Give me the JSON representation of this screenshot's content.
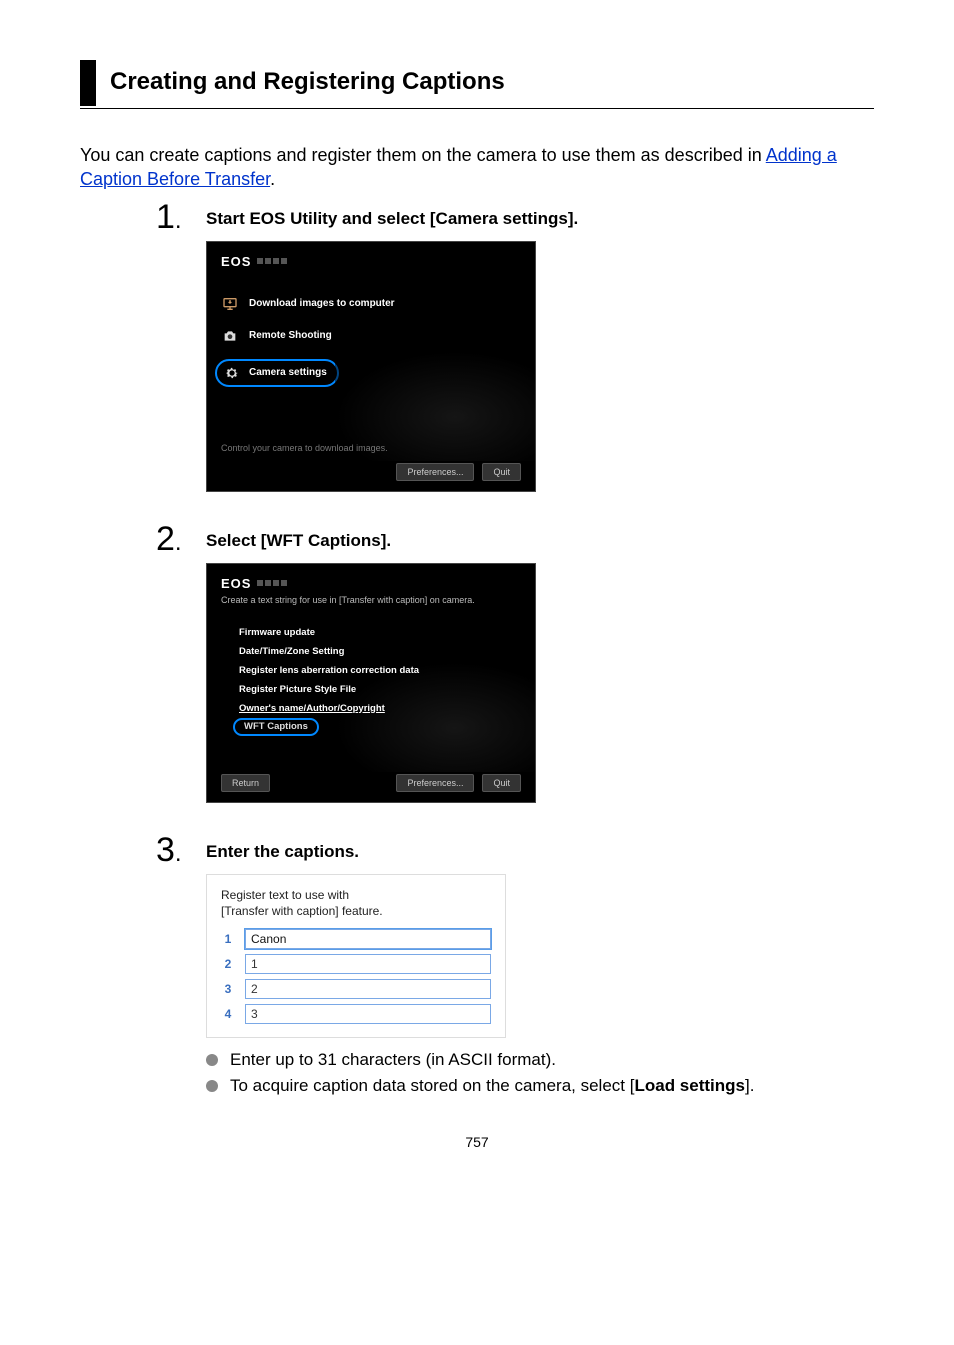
{
  "page": {
    "title": "Creating and Registering Captions",
    "intro_before_link": "You can create captions and register them on the camera to use them as described in ",
    "link_text": "Adding a Caption Before Transfer",
    "intro_after_link": ".",
    "page_number": "757"
  },
  "steps": [
    {
      "num": "1",
      "heading": "Start EOS Utility and select [Camera settings].",
      "panel1": {
        "logo": "EOS",
        "options": {
          "download": "Download images to computer",
          "remote": "Remote Shooting",
          "settings": "Camera settings"
        },
        "footer_text": "Control your camera to download images.",
        "btn_prefs": "Preferences...",
        "btn_quit": "Quit"
      }
    },
    {
      "num": "2",
      "heading": "Select [WFT Captions].",
      "panel2": {
        "logo": "EOS",
        "subtitle": "Create a text string for use in [Transfer with caption] on camera.",
        "items": [
          "Firmware update",
          "Date/Time/Zone Setting",
          "Register lens aberration correction data",
          "Register Picture Style File",
          "Owner's name/Author/Copyright"
        ],
        "wft": "WFT Captions",
        "btn_return": "Return",
        "btn_prefs": "Preferences...",
        "btn_quit": "Quit"
      }
    },
    {
      "num": "3",
      "heading": "Enter the captions.",
      "dialog3": {
        "title_line1": "Register text to use with",
        "title_line2": "[Transfer with caption] feature.",
        "rows": [
          {
            "n": "1",
            "v": "Canon"
          },
          {
            "n": "2",
            "v": "1"
          },
          {
            "n": "3",
            "v": "2"
          },
          {
            "n": "4",
            "v": "3"
          }
        ]
      },
      "bullets": {
        "b1": "Enter up to 31 characters (in ASCII format).",
        "b2_before": "To acquire caption data stored on the camera, select [",
        "b2_bold": "Load settings",
        "b2_after": "]."
      }
    }
  ]
}
